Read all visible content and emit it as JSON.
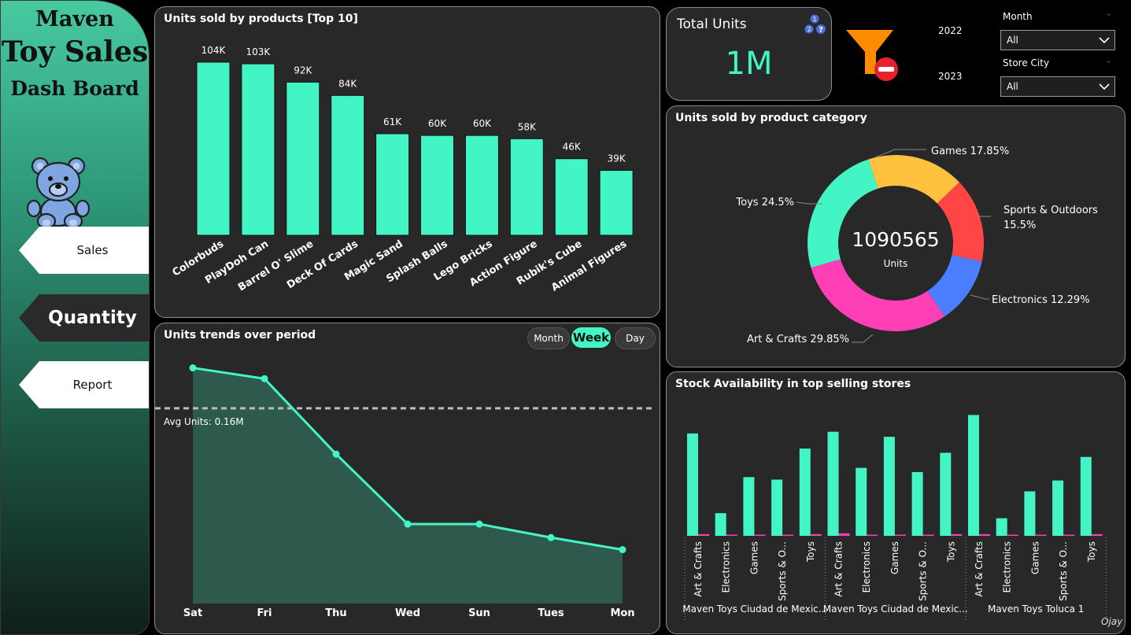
{
  "brand": {
    "line1": "Maven",
    "line2": "Toy Sales",
    "line3": "Dash Board"
  },
  "nav": {
    "sales": "Sales",
    "quantity": "Quantity",
    "report": "Report"
  },
  "total_units": {
    "label": "Total Units",
    "value": "1M"
  },
  "year_filter": {
    "years": [
      "2022",
      "2023"
    ]
  },
  "filters": {
    "month_label": "Month",
    "month_value": "All",
    "city_label": "Store City",
    "city_value": "All"
  },
  "trend_buttons": {
    "month": "Month",
    "week": "Week",
    "day": "Day",
    "active": "Week"
  },
  "colors": {
    "accent": "#43f5c4",
    "panel": "#282828",
    "pink": "#ff3fb6",
    "yellow": "#ffc23e",
    "red": "#ff4545",
    "blue": "#4a7fff",
    "funnel": "#ff8c00"
  },
  "icons": {
    "teddy": "teddy-bear-icon",
    "filter": "clear-filter-icon",
    "help": "help-icon"
  },
  "signature": "Ojay",
  "chart_data": [
    {
      "id": "top-products",
      "type": "bar",
      "title": "Units sold by products [Top 10]",
      "categories": [
        "Colorbuds",
        "PlayDoh Can",
        "Barrel O' Slime",
        "Deck Of Cards",
        "Magic Sand",
        "Splash Balls",
        "Lego Bricks",
        "Action Figure",
        "Rubik's Cube",
        "Animal Figures"
      ],
      "values": [
        104,
        103,
        92,
        84,
        61,
        60,
        60,
        58,
        46,
        39
      ],
      "data_labels": [
        "104K",
        "103K",
        "92K",
        "84K",
        "61K",
        "60K",
        "60K",
        "58K",
        "46K",
        "39K"
      ],
      "ylim": [
        0,
        104
      ]
    },
    {
      "id": "category-donut",
      "type": "pie",
      "title": "Units sold by product category",
      "center_value": "1090565",
      "center_label": "Units",
      "slices": [
        {
          "name": "Games",
          "value": 17.85,
          "label": "Games 17.85%",
          "color": "#ffc23e"
        },
        {
          "name": "Sports & Outdoors",
          "value": 15.5,
          "label": "Sports & Outdoors 15.5%",
          "color": "#ff4545"
        },
        {
          "name": "Electronics",
          "value": 12.29,
          "label": "Electronics 12.29%",
          "color": "#4a7fff"
        },
        {
          "name": "Art & Crafts",
          "value": 29.85,
          "label": "Art & Crafts 29.85%",
          "color": "#ff3fb6"
        },
        {
          "name": "Toys",
          "value": 24.5,
          "label": "Toys 24.5%",
          "color": "#43f5c4"
        }
      ]
    },
    {
      "id": "units-trend",
      "type": "area",
      "title": "Units trends over period",
      "x": [
        "Sat",
        "Fri",
        "Thu",
        "Wed",
        "Sun",
        "Tues",
        "Mon"
      ],
      "y": [
        0.19,
        0.182,
        0.126,
        0.074,
        0.074,
        0.064,
        0.055
      ],
      "avg_label": "Avg Units: 0.16M",
      "avg_value": 0.16,
      "ylim": [
        0.015,
        0.195
      ]
    },
    {
      "id": "stock-availability",
      "type": "bar",
      "title": "Stock Availability in top selling stores",
      "groups": [
        {
          "label": "Maven Toys Ciudad de Mexic...",
          "categories": [
            "Art & Crafts",
            "Electronics",
            "Games",
            "Sports & O...",
            "Toys"
          ],
          "in_stock": [
            122,
            27,
            70,
            67,
            104
          ],
          "out_of_stock": [
            2,
            1,
            1,
            1,
            2
          ]
        },
        {
          "label": "Maven Toys Ciudad de Mexic...",
          "categories": [
            "Art & Crafts",
            "Electronics",
            "Games",
            "Sports & O...",
            "Toys"
          ],
          "in_stock": [
            124,
            81,
            118,
            76,
            99
          ],
          "out_of_stock": [
            3,
            1,
            1,
            1,
            2
          ]
        },
        {
          "label": "Maven Toys Toluca 1",
          "categories": [
            "Art & Crafts",
            "Electronics",
            "Games",
            "Sports & O...",
            "Toys"
          ],
          "in_stock": [
            144,
            21,
            53,
            66,
            94
          ],
          "out_of_stock": [
            2,
            1,
            1,
            1,
            2
          ]
        }
      ],
      "ylim": [
        0,
        150
      ]
    }
  ]
}
